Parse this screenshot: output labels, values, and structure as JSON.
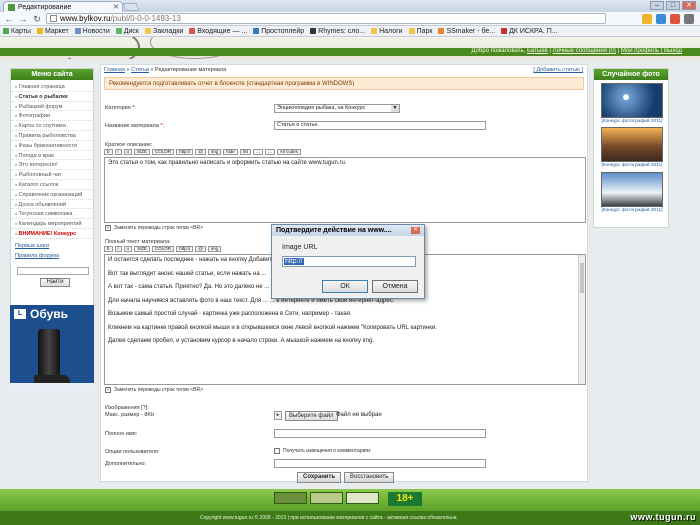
{
  "browser": {
    "tab_title": "Редактирование",
    "url_host": "www.bylkov.ru",
    "url_path": "/publ/0-0-0-1493-13",
    "bookmarks": [
      "Карты",
      "Маркет",
      "Новости",
      "Диск",
      "Закладки",
      "Входящие — ...",
      "Простоплейр",
      "Rhymes: сло...",
      "Налоги",
      "Парк",
      "SSmaker - бе...",
      "ДК ИСКРА. П..."
    ]
  },
  "userbar": {
    "greeting": "Добро пожаловать,",
    "name": "Батыев",
    "messages": "Личные сообщения (0)",
    "links": "Мой профиль | Выход"
  },
  "sidebar": {
    "title": "Меню сайта",
    "items": [
      "Главная страница",
      "Статьи о рыбалке",
      "Рыбацкий форум",
      "Фотографии",
      "Карты со спутника",
      "Правила рыболовства",
      "Фазы брикоактивности",
      "Погода в крае",
      "Это интересно!",
      "Рыболовный чат",
      "Каталог ссылок",
      "Справочник организаций",
      "Доска объявлений",
      "Тогунская символика",
      "Календарь мероприятий",
      "ВНИМАНИЕ! Конкурс"
    ],
    "sub_links": [
      "Первые шаги",
      "Правила форума"
    ],
    "login_button": "Найти",
    "ad_title": "Обувь",
    "ad_logo": "L"
  },
  "main": {
    "breadcrumb_home": "Главная",
    "breadcrumb_articles": "Статьи",
    "breadcrumb_current": "Редактирование материала",
    "add_article": "[ Добавить статью ]",
    "notice": "Рекомендуется подготавливать отчет в блокноте (стандартная программа в WINDOWS)",
    "category_label": "Категория",
    "category_value": "Энциклопедия рыбака, на Конкурс",
    "title_label": "Название материала",
    "title_value": "Статья о статье.",
    "short_label": "Краткое описание:",
    "short_text": "Это статья о том, как правильно написать и оформить статью на сайте www.tugun.ru.",
    "replace_label": "Заменять переводы строк тегом <BR>",
    "full_label": "Полный текст материала:",
    "full_lines": [
      "И остается сделать последнее - нажать на кнопку Добавить ...                                         ... жизнью.",
      "Вот так выглядит анонс нашей статьи, если нажать на ...",
      "А вот так - сама статья. Приятно? Да. Но это далеко не ...                     ... ваем нашу статью красивой.",
      "Для начала научимся вставлять фото в наш текст. Для ...                                     ... в интернете и иметь свой интернет-адрес.",
      "Возьмем самый простой случай - картинка уже расположена в Сети, например - такая.",
      "Кликнем на картинке правой кнопкой мыши и в открывшемся окне левой кнопкой нажмем \"Копировать URL картинки.",
      "Далее сделаем пробел, и установим курсор в начало строки. А мышкой нажмем на кнопку img."
    ],
    "images_label": "Изображения [?]:",
    "images_sub": "Макс. размер - 8Kb",
    "browse_button": "Выберите файл",
    "file_status": "Файл не выбран",
    "name_label": "Полное имя:",
    "options_label": "Опции пользователя:",
    "notify_label": "Получать извещения о комментариях",
    "extra_label": "Дополнительно:",
    "save_button": "Сохранить",
    "restore_button": "Восстановить",
    "bbcode_tags": [
      "b",
      "i",
      "u",
      "SIZE",
      "COLOR",
      "http://",
      "@",
      "img",
      "hide",
      "list",
      "...",
      "...",
      "All codes"
    ]
  },
  "right": {
    "title": "Случайное фото",
    "captions": [
      "[Конкурс фотографий 2011]",
      "[Конкурс фотографий 2011]",
      "[Конкурс фотографий 2011]"
    ]
  },
  "dialog": {
    "title": "Подтвердите действие на www....",
    "label": "Image URL",
    "value": "http://",
    "ok": "ОК",
    "cancel": "Отмена"
  },
  "footer": {
    "badge": "18+",
    "copyright": "Copyright www.tugun.ru © 2008 - 2013 | при использовании материалов с сайта - активная ссылка обязательна",
    "watermark": "www.tugun.ru"
  },
  "colors": {
    "green_head": "#4b8a1e",
    "link": "#255e9a",
    "notice_bg": "#fdebd6"
  }
}
